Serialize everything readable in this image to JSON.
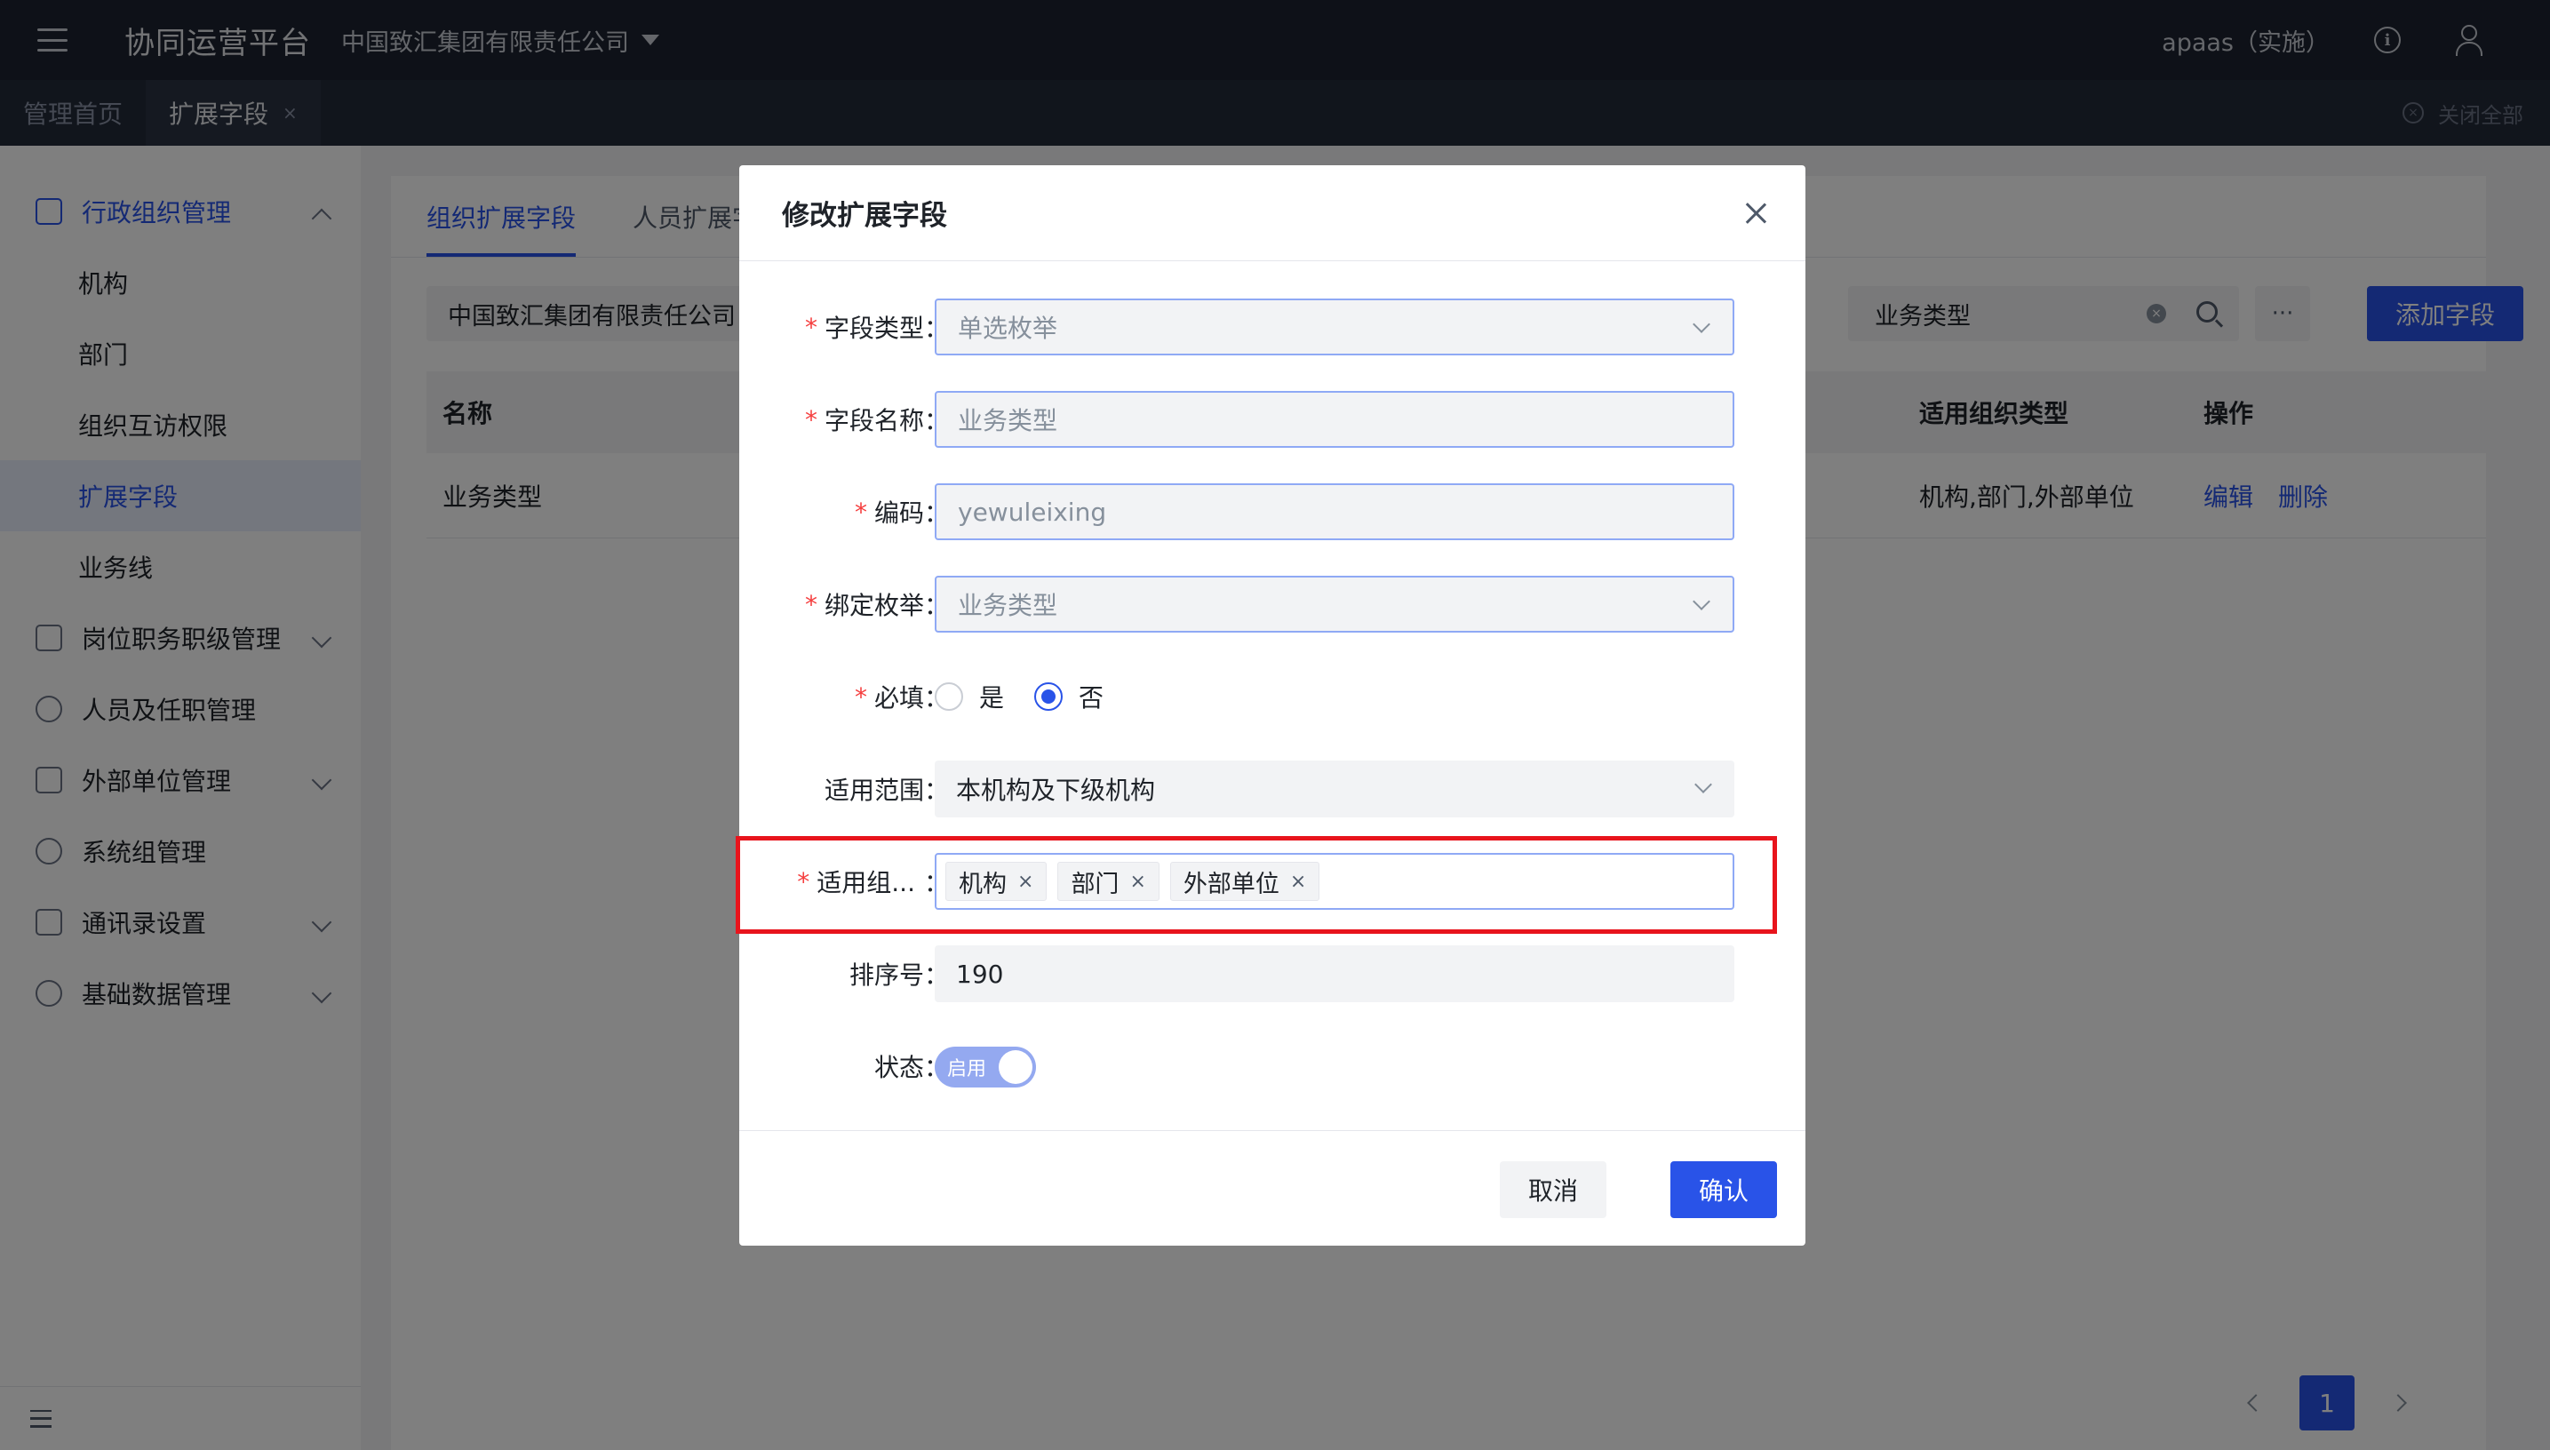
{
  "topbar": {
    "app_title": "协同运营平台",
    "company": "中国致汇集团有限责任公司",
    "user": "apaas（实施）"
  },
  "tabs": [
    {
      "label": "管理首页"
    },
    {
      "label": "扩展字段",
      "close": "×"
    }
  ],
  "close_all": "关闭全部",
  "sidebar": {
    "groups": [
      {
        "label": "行政组织管理",
        "icon": "bank-icon"
      },
      {
        "label": "岗位职务职级管理",
        "icon": "badge-icon"
      },
      {
        "label": "人员及任职管理",
        "icon": "person-icon"
      },
      {
        "label": "外部单位管理",
        "icon": "external-org-icon"
      },
      {
        "label": "系统组管理",
        "icon": "group-icon"
      },
      {
        "label": "通讯录设置",
        "icon": "contacts-icon"
      },
      {
        "label": "基础数据管理",
        "icon": "database-icon"
      }
    ],
    "sub_items": [
      {
        "label": "机构"
      },
      {
        "label": "部门"
      },
      {
        "label": "组织互访权限"
      },
      {
        "label": "扩展字段"
      },
      {
        "label": "业务线"
      }
    ]
  },
  "main": {
    "tabs": [
      {
        "label": "组织扩展字段"
      },
      {
        "label": "人员扩展字"
      }
    ],
    "org_filter": "中国致汇集团有限责任公司",
    "search_value": "业务类型",
    "more": "···",
    "add_button": "添加字段",
    "table": {
      "headers": {
        "name": "名称",
        "org_types": "适用组织类型",
        "actions": "操作"
      },
      "rows": [
        {
          "name": "业务类型",
          "org_types": "机构,部门,外部单位",
          "edit": "编辑",
          "delete": "删除"
        }
      ]
    },
    "pagination": {
      "current": "1"
    }
  },
  "modal": {
    "title": "修改扩展字段",
    "fields": {
      "field_type": {
        "label": "字段类型",
        "value": "单选枚举",
        "required": "*"
      },
      "field_name": {
        "label": "字段名称",
        "value": "业务类型",
        "required": "*"
      },
      "code": {
        "label": "编码",
        "value": "yewuleixing",
        "required": "*"
      },
      "bind_enum": {
        "label": "绑定枚举",
        "value": "业务类型",
        "required": "*"
      },
      "required_field": {
        "label": "必填",
        "required": "*",
        "option_yes": "是",
        "option_no": "否",
        "selected": "否"
      },
      "scope": {
        "label": "适用范围",
        "value": "本机构及下级机构"
      },
      "org_types": {
        "label": "适用组...",
        "required": "*",
        "tags": [
          "机构",
          "部门",
          "外部单位"
        ]
      },
      "sort": {
        "label": "排序号",
        "value": "190"
      },
      "status": {
        "label": "状态",
        "value": "启用"
      }
    },
    "colon": "：",
    "cancel": "取消",
    "confirm": "确认"
  },
  "colors": {
    "primary": "#2953e8",
    "required": "#f53f3f",
    "highlight": "#e8141c",
    "topbar": "#1c2230"
  }
}
